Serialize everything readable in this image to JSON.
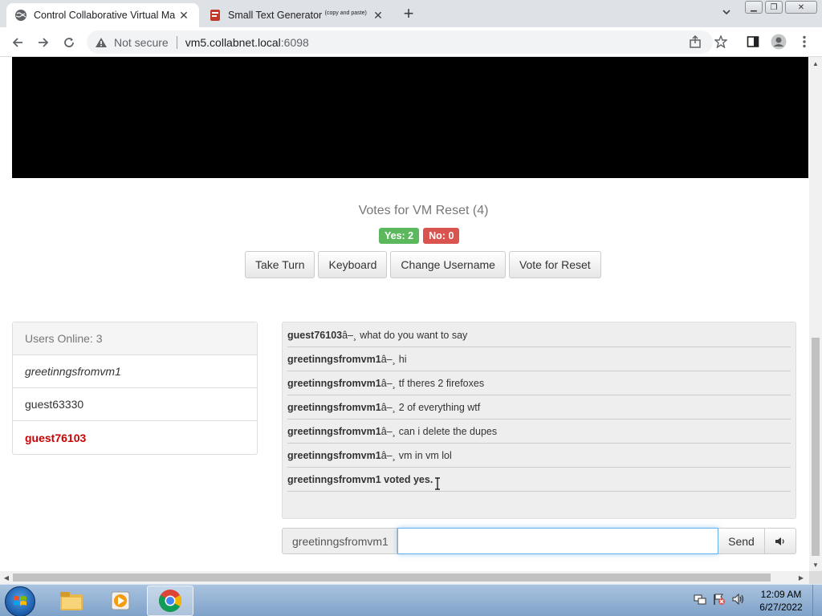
{
  "browser": {
    "tabs": [
      {
        "title": "Control Collaborative Virtual Ma",
        "active": true
      },
      {
        "title": "Small Text Generator",
        "title_suffix": "(copy and paste)",
        "active": false
      }
    ],
    "address": {
      "security": "Not secure",
      "host": "vm5.collabnet.local",
      "port": ":6098"
    }
  },
  "page": {
    "votes_title": "Votes for VM Reset (4)",
    "yes_badge": "Yes: 2",
    "no_badge": "No: 0",
    "buttons": {
      "take_turn": "Take Turn",
      "keyboard": "Keyboard",
      "change_username": "Change Username",
      "vote_reset": "Vote for Reset"
    },
    "users": {
      "header": "Users Online: 3",
      "list": [
        "greetinngsfromvm1",
        "guest63330",
        "guest76103"
      ]
    },
    "chat": {
      "messages": [
        {
          "user": "guest76103",
          "sep": "â–¸",
          "text": "what do you want to say"
        },
        {
          "user": "greetinngsfromvm1",
          "sep": "â–¸",
          "text": "hi"
        },
        {
          "user": "greetinngsfromvm1",
          "sep": "â–¸",
          "text": "tf theres 2 firefoxes"
        },
        {
          "user": "greetinngsfromvm1",
          "sep": "â–¸",
          "text": "2 of everything wtf"
        },
        {
          "user": "greetinngsfromvm1",
          "sep": "â–¸",
          "text": "can i delete the dupes"
        },
        {
          "user": "greetinngsfromvm1",
          "sep": "â–¸",
          "text": "vm in vm lol"
        }
      ],
      "system_message": "greetinngsfromvm1 voted yes.",
      "username": "greetinngsfromvm1",
      "input_value": "",
      "send_label": "Send"
    }
  },
  "taskbar": {
    "time": "12:09 AM",
    "date": "6/27/2022"
  },
  "colors": {
    "yes": "#5cb85c",
    "no": "#d9534f",
    "turn_user": "#cc0000"
  }
}
